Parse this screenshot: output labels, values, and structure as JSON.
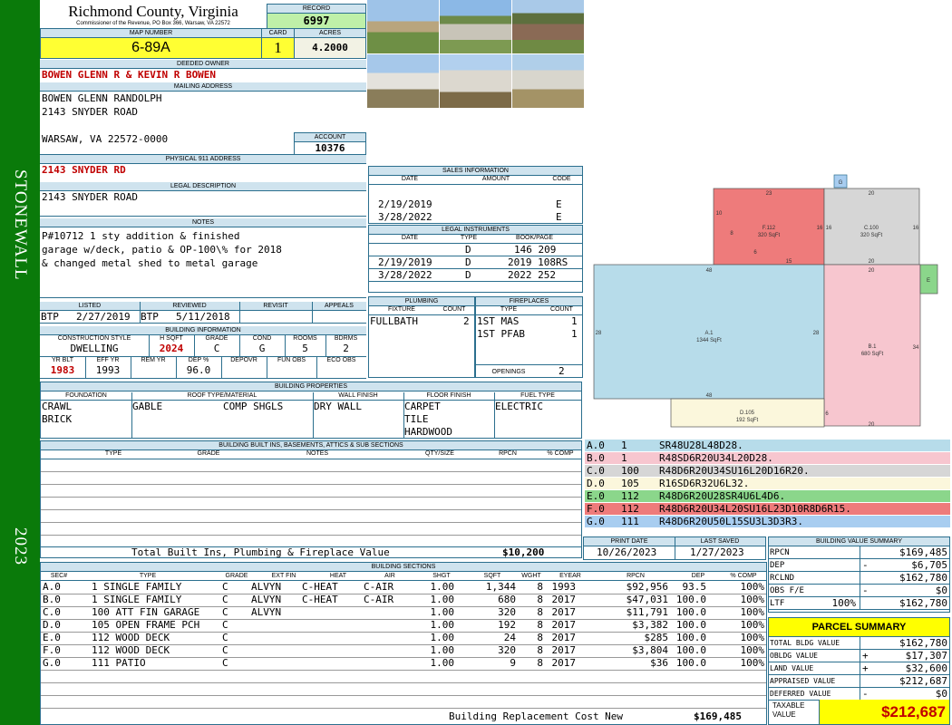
{
  "sidebar": {
    "district": "STONEWALL",
    "year": "2023"
  },
  "header": {
    "county": "Richmond County, Virginia",
    "address": "Commissioner of the Revenue, PO Box 366, Warsaw, VA 22572",
    "record_label": "RECORD",
    "record": "6997",
    "map_label": "MAP NUMBER",
    "map": "6-89A",
    "card_label": "CARD",
    "card": "1",
    "acres_label": "ACRES",
    "acres": "4.2000"
  },
  "owner": {
    "label": "DEEDED OWNER",
    "name": "BOWEN GLENN R & KEVIN R BOWEN"
  },
  "mailing": {
    "label": "MAILING ADDRESS",
    "line1": "BOWEN GLENN RANDOLPH",
    "line2": "2143 SNYDER ROAD",
    "line3": "WARSAW, VA 22572-0000",
    "account_label": "ACCOUNT",
    "account": "10376"
  },
  "physical": {
    "label": "PHYSICAL 911 ADDRESS",
    "value": "2143 SNYDER RD"
  },
  "legal": {
    "label": "LEGAL DESCRIPTION",
    "value": "2143 SNYDER ROAD"
  },
  "notes": {
    "label": "NOTES",
    "line1": "P#10712 1 sty addition & finished",
    "line2": "garage w/deck, patio & OP-100\\% for 2018",
    "line3": "& changed metal shed to metal garage"
  },
  "review": {
    "listed_label": "LISTED",
    "listed_by": "BTP",
    "listed_date": "2/27/2019",
    "reviewed_label": "REVIEWED",
    "reviewed_by": "BTP",
    "reviewed_date": "5/11/2018",
    "revisit_label": "REVISIT",
    "appeals_label": "APPEALS"
  },
  "building_info": {
    "label": "BUILDING INFORMATION",
    "h": [
      "CONSTRUCTION STYLE",
      "H SQFT",
      "GRADE",
      "COND",
      "ROOMS",
      "BDRMS"
    ],
    "style": "DWELLING",
    "hsqft": "2024",
    "grade": "C",
    "cond": "G",
    "rooms": "5",
    "bdrms": "2",
    "h2": [
      "YR BLT",
      "EFF YR",
      "REM YR",
      "DEP %",
      "DEPOVR",
      "FUN OBS",
      "ECO OBS"
    ],
    "yrblt": "1983",
    "effyr": "1993",
    "remyr": "",
    "dep": "96.0"
  },
  "sales": {
    "label": "SALES INFORMATION",
    "h": [
      "DATE",
      "AMOUNT",
      "CODE"
    ],
    "rows": [
      {
        "date": "2/19/2019",
        "code": "E"
      },
      {
        "date": "3/28/2022",
        "code": "E"
      }
    ]
  },
  "instruments": {
    "label": "LEGAL INSTRUMENTS",
    "h": [
      "DATE",
      "TYPE",
      "BOOK/PAGE"
    ],
    "rows": [
      {
        "date": "",
        "type": "D",
        "book": "146 209"
      },
      {
        "date": "2/19/2019",
        "type": "D",
        "book": "2019 108RS"
      },
      {
        "date": "3/28/2022",
        "type": "D",
        "book": "2022 252"
      }
    ]
  },
  "plumbing": {
    "label": "PLUMBING",
    "h": [
      "FIXTURE",
      "COUNT"
    ],
    "fixture": "FULLBATH",
    "count": "2"
  },
  "fireplaces": {
    "label": "FIREPLACES",
    "h": [
      "TYPE",
      "COUNT"
    ],
    "rows": [
      {
        "type": "1ST MAS",
        "count": "1"
      },
      {
        "type": "1ST PFAB",
        "count": "1"
      }
    ],
    "openings_label": "OPENINGS",
    "openings": "2"
  },
  "properties": {
    "label": "BUILDING PROPERTIES",
    "h": [
      "FOUNDATION",
      "ROOF TYPE/MATERIAL",
      "WALL FINISH",
      "FLOOR FINISH",
      "FUEL TYPE"
    ],
    "foundation": [
      "CRAWL",
      "BRICK"
    ],
    "roof_type": "GABLE",
    "roof_mat": "COMP SHGLS",
    "wall": "DRY WALL",
    "floor": [
      "CARPET",
      "TILE",
      "HARDWOOD"
    ],
    "fuel": "ELECTRIC"
  },
  "builtins": {
    "label": "BUILDING BUILT INS, BASEMENTS, ATTICS & SUB SECTIONS",
    "h": [
      "TYPE",
      "GRADE",
      "NOTES",
      "QTY/SIZE",
      "RPCN",
      "% COMP"
    ],
    "total_label": "Total Built Ins, Plumbing & Fireplace Value",
    "total": "$10,200"
  },
  "dates": {
    "print_label": "PRINT DATE",
    "print": "10/26/2023",
    "saved_label": "LAST SAVED",
    "saved": "1/27/2023"
  },
  "sketch_legend": [
    {
      "sec": "A.0",
      "code": "1",
      "path": "SR48U28L48D28.",
      "color": "#b7dcea"
    },
    {
      "sec": "B.0",
      "code": "1",
      "path": "R48SD6R20U34L20D28.",
      "color": "#f7c6cf"
    },
    {
      "sec": "C.0",
      "code": "100",
      "path": "R48D6R20U34SU16L20D16R20.",
      "color": "#d6d6d6"
    },
    {
      "sec": "D.0",
      "code": "105",
      "path": "R16SD6R32U6L32.",
      "color": "#fbf7dc"
    },
    {
      "sec": "E.0",
      "code": "112",
      "path": "R48D6R20U28SR4U6L4D6.",
      "color": "#8bd68b"
    },
    {
      "sec": "F.0",
      "code": "112",
      "path": "R48D6R20U34L20SU16L23D10R8D6R15.",
      "color": "#ee7b7b"
    },
    {
      "sec": "G.0",
      "code": "111",
      "path": "R48D6R20U50L15SU3L3D3R3.",
      "color": "#a8cdf0"
    }
  ],
  "sketch": {
    "a_label": "A.1",
    "a_area": "1344 SqFt",
    "b_label": "B.1",
    "b_area": "680 SqFt",
    "c_label": "C.100",
    "c_area": "320 SqFt",
    "d_label": "D.105",
    "d_area": "192 SqFt",
    "f_label": "F.112",
    "f_area": "320 SqFt",
    "e_label": "E",
    "g_label": "G",
    "dims": [
      "23",
      "20",
      "10",
      "16",
      "16",
      "16",
      "8",
      "6",
      "15",
      "20",
      "48",
      "20",
      "28",
      "28",
      "34",
      "48",
      "6",
      "20"
    ]
  },
  "sections": {
    "label": "BUILDING SECTIONS",
    "h": [
      "SEC#",
      "TYPE",
      "GRADE",
      "EXT FIN",
      "HEAT",
      "AIR",
      "SHGT",
      "SQFT",
      "WGHT",
      "EYEAR",
      "RPCN",
      "DEP",
      "% COMP"
    ],
    "rows": [
      [
        "A.0",
        "1 SINGLE FAMILY",
        "C",
        "ALVYN",
        "C-HEAT",
        "C-AIR",
        "1.00",
        "1,344",
        "8",
        "1993",
        "$92,956",
        "93.5",
        "100%"
      ],
      [
        "B.0",
        "1 SINGLE FAMILY",
        "C",
        "ALVYN",
        "C-HEAT",
        "C-AIR",
        "1.00",
        "680",
        "8",
        "2017",
        "$47,031",
        "100.0",
        "100%"
      ],
      [
        "C.0",
        "100 ATT FIN GARAGE",
        "C",
        "ALVYN",
        "",
        "",
        "1.00",
        "320",
        "8",
        "2017",
        "$11,791",
        "100.0",
        "100%"
      ],
      [
        "D.0",
        "105 OPEN FRAME PCH",
        "C",
        "",
        "",
        "",
        "1.00",
        "192",
        "8",
        "2017",
        "$3,382",
        "100.0",
        "100%"
      ],
      [
        "E.0",
        "112 WOOD DECK",
        "C",
        "",
        "",
        "",
        "1.00",
        "24",
        "8",
        "2017",
        "$285",
        "100.0",
        "100%"
      ],
      [
        "F.0",
        "112 WOOD DECK",
        "C",
        "",
        "",
        "",
        "1.00",
        "320",
        "8",
        "2017",
        "$3,804",
        "100.0",
        "100%"
      ],
      [
        "G.0",
        "111 PATIO",
        "C",
        "",
        "",
        "",
        "1.00",
        "9",
        "8",
        "2017",
        "$36",
        "100.0",
        "100%"
      ]
    ],
    "total_label": "Building Replacement Cost New",
    "total": "$169,485"
  },
  "value_summary": {
    "label": "BUILDING VALUE SUMMARY",
    "rows": [
      {
        "k": "RPCN",
        "s": "",
        "v": "$169,485"
      },
      {
        "k": "DEP",
        "s": "-",
        "v": "$6,705"
      },
      {
        "k": "RCLND",
        "s": "",
        "v": "$162,780"
      },
      {
        "k": "OBS F/E",
        "s": "-",
        "v": "$0"
      },
      {
        "k": "LTF",
        "p": "100%",
        "s": "",
        "v": "$162,780"
      }
    ]
  },
  "parcel": {
    "label": "PARCEL SUMMARY",
    "rows": [
      {
        "k": "TOTAL BLDG VALUE",
        "s": "",
        "v": "$162,780"
      },
      {
        "k": "OBLDG VALUE",
        "s": "+",
        "v": "$17,307"
      },
      {
        "k": "LAND VALUE",
        "s": "+",
        "v": "$32,600"
      },
      {
        "k": "APPRAISED VALUE",
        "s": "",
        "v": "$212,687"
      },
      {
        "k": "DEFERRED VALUE",
        "s": "-",
        "v": "$0"
      }
    ],
    "taxable_label": "TAXABLE VALUE",
    "taxable": "$212,687"
  }
}
